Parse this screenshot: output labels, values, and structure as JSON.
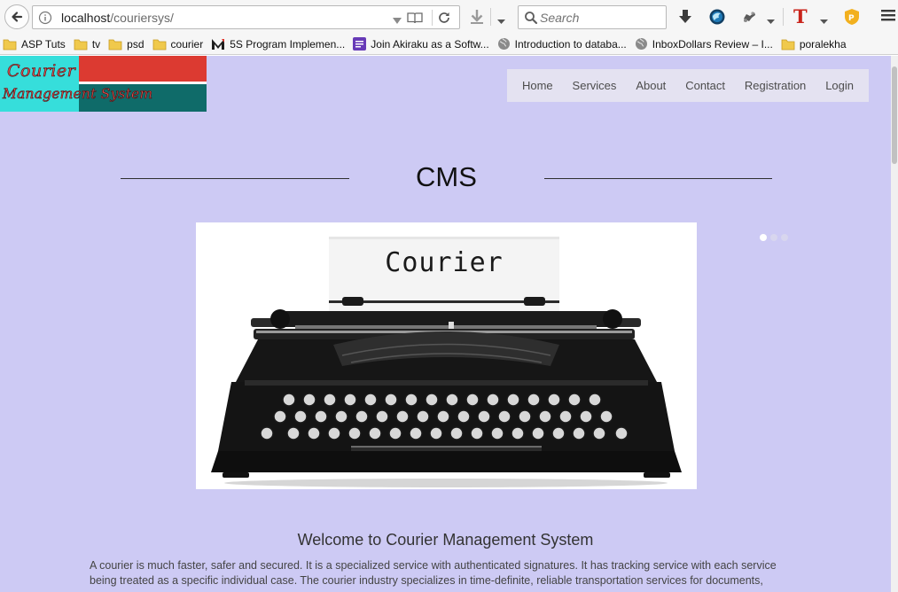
{
  "browser": {
    "url_host": "localhost",
    "url_path": "/couriersys/",
    "search_placeholder": "Search",
    "bookmarks": [
      {
        "label": "ASP Tuts",
        "icon": "folder-icon"
      },
      {
        "label": "tv",
        "icon": "folder-icon"
      },
      {
        "label": "psd",
        "icon": "folder-icon"
      },
      {
        "label": "courier",
        "icon": "folder-icon"
      },
      {
        "label": "5S Program Implemen...",
        "icon": "m-logo-icon"
      },
      {
        "label": "Join Akiraku as a Softw...",
        "icon": "form-icon"
      },
      {
        "label": "Introduction to databa...",
        "icon": "globe-icon"
      },
      {
        "label": "InboxDollars Review – I...",
        "icon": "globe-icon"
      },
      {
        "label": "poralekha",
        "icon": "folder-icon"
      }
    ]
  },
  "site": {
    "logo_line1": "Courier",
    "logo_line2": "Management System",
    "nav": [
      "Home",
      "Services",
      "About",
      "Contact",
      "Registration",
      "Login"
    ],
    "title": "CMS",
    "slide_text": "Courier",
    "slide_count": 3,
    "slide_active": 0,
    "welcome": "Welcome to Courier Management System",
    "about": "A courier is much faster, safer and secured. It is a specialized service with authenticated signatures. It has tracking service with each service being treated as a specific individual case. The courier industry specializes in time-definite, reliable transportation services for documents,"
  },
  "colors": {
    "page_bg": "#cdcaf4",
    "logo_cyan": "#36dedb",
    "logo_red": "#dc3a31",
    "logo_teal": "#0f6b69"
  }
}
